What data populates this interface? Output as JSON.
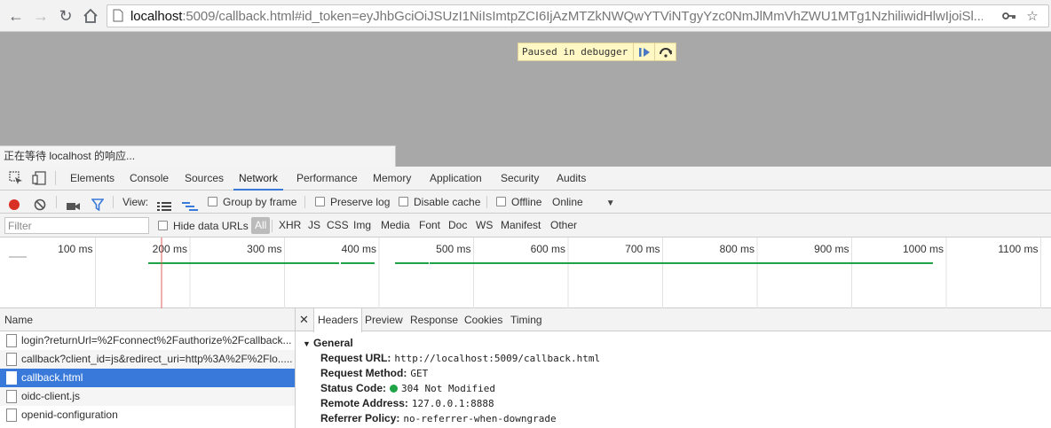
{
  "browser": {
    "url_host": "localhost",
    "url_rest": ":5009/callback.html#id_token=eyJhbGciOiJSUzI1NiIsImtpZCI6IjAzMTZkNWQwYTViNTgyYzc0NmJlMmVhZWU1MTg1NzhiliwidHlwIjoiSl..."
  },
  "viewport": {
    "paused_text": "Paused in debugger",
    "status_text": "正在等待 localhost 的响应..."
  },
  "devtools": {
    "tabs": [
      "Elements",
      "Console",
      "Sources",
      "Network",
      "Performance",
      "Memory",
      "Application",
      "Security",
      "Audits"
    ],
    "active_tab": "Network",
    "toolbar": {
      "view_label": "View:",
      "group_by_frame": "Group by frame",
      "preserve_log": "Preserve log",
      "disable_cache": "Disable cache",
      "offline": "Offline",
      "throttle": "Online"
    },
    "filter": {
      "placeholder": "Filter",
      "hide_data_urls": "Hide data URLs",
      "types": [
        "All",
        "XHR",
        "JS",
        "CSS",
        "Img",
        "Media",
        "Font",
        "Doc",
        "WS",
        "Manifest",
        "Other"
      ],
      "selected_type": "All"
    },
    "overview": {
      "ticks": [
        "100 ms",
        "200 ms",
        "300 ms",
        "400 ms",
        "500 ms",
        "600 ms",
        "700 ms",
        "800 ms",
        "900 ms",
        "1000 ms",
        "1100 ms"
      ]
    },
    "requests": {
      "header": "Name",
      "rows": [
        "login?returnUrl=%2Fconnect%2Fauthorize%2Fcallback...",
        "callback?client_id=js&redirect_uri=http%3A%2F%2Flo.....",
        "callback.html",
        "oidc-client.js",
        "openid-configuration"
      ],
      "selected_index": 2
    },
    "details": {
      "tabs": [
        "Headers",
        "Preview",
        "Response",
        "Cookies",
        "Timing"
      ],
      "active_tab": "Headers",
      "section_title": "General",
      "fields": [
        {
          "key": "Request URL:",
          "value": "http://localhost:5009/callback.html"
        },
        {
          "key": "Request Method:",
          "value": "GET"
        },
        {
          "key": "Status Code:",
          "value": "304 Not Modified"
        },
        {
          "key": "Remote Address:",
          "value": "127.0.0.1:8888"
        },
        {
          "key": "Referrer Policy:",
          "value": "no-referrer-when-downgrade"
        }
      ]
    }
  },
  "colors": {
    "accent": "#3879d9",
    "record": "#d93025",
    "timeline_bar": "#1ea446",
    "marker": "#e06060",
    "status_ok": "#1ea446"
  }
}
